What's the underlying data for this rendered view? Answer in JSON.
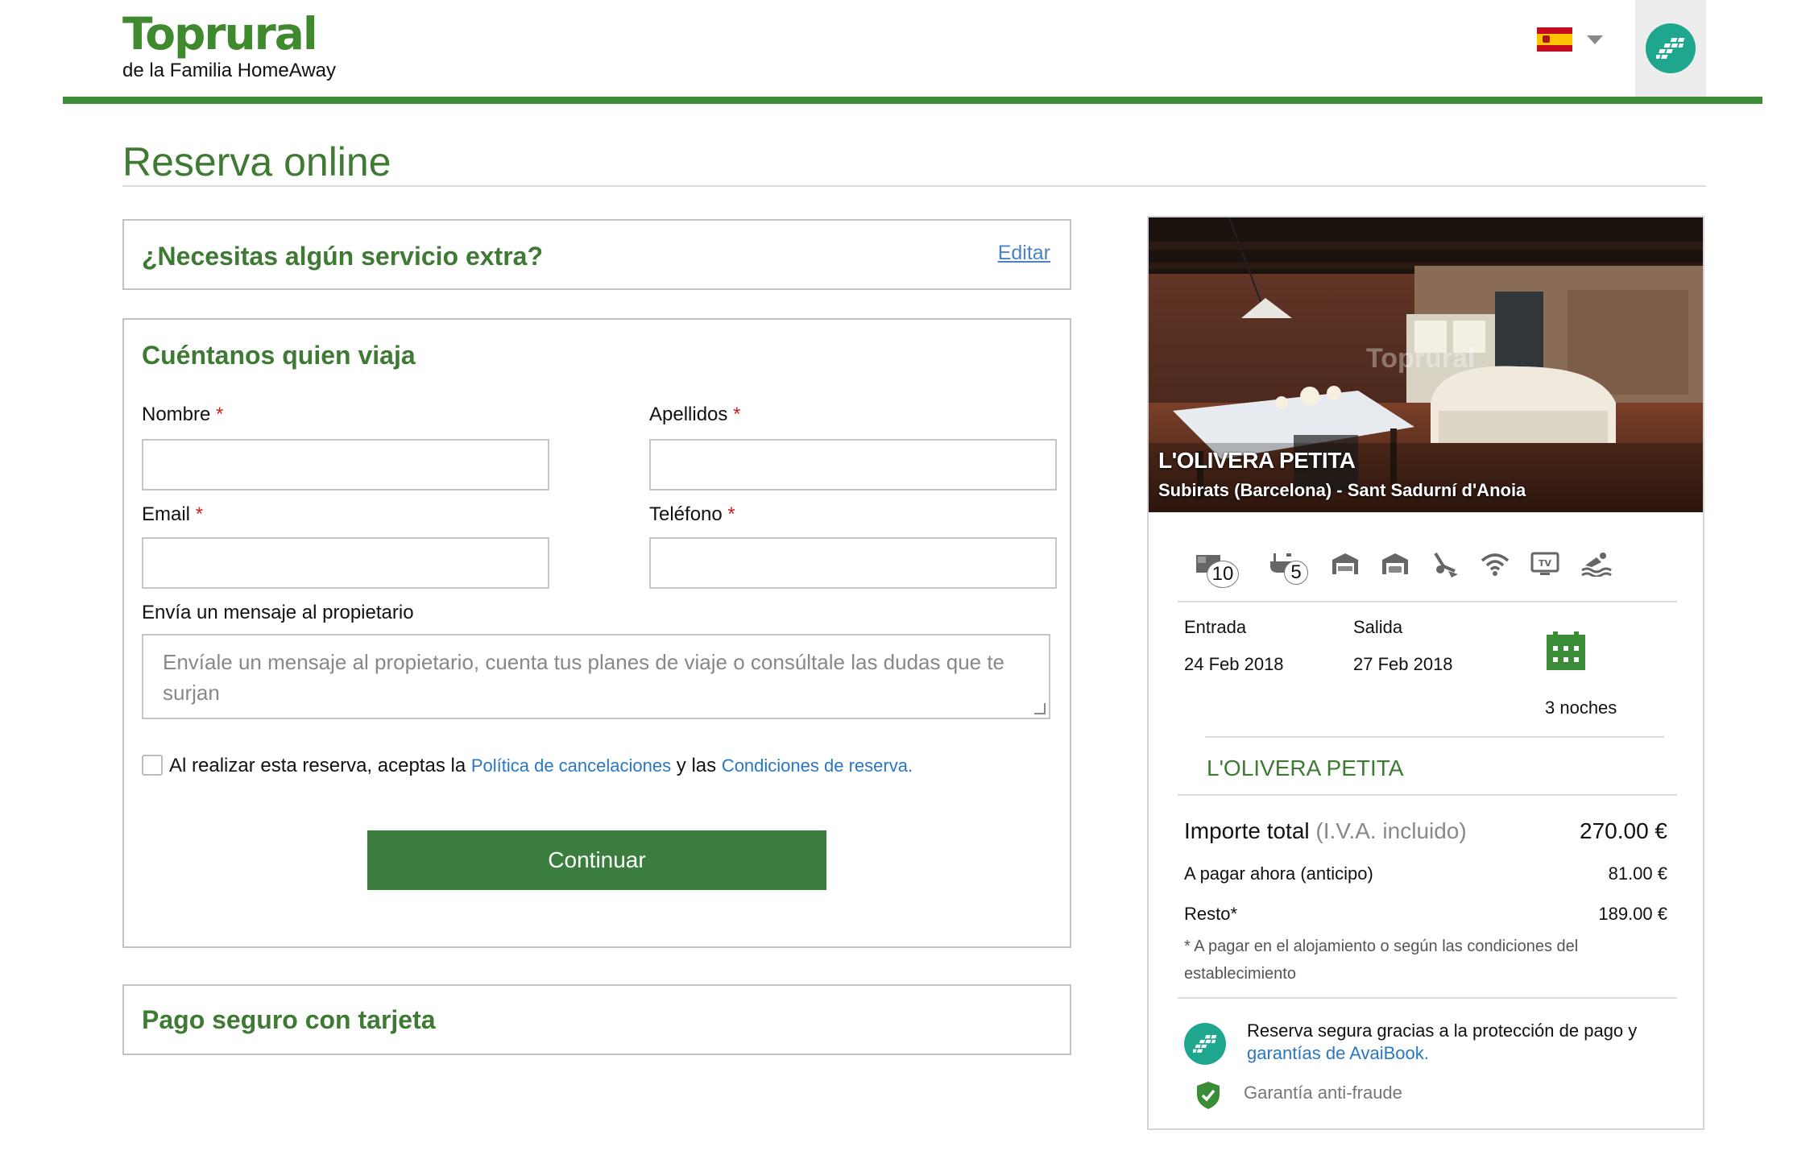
{
  "header": {
    "logo_name": "Toprural",
    "logo_sub": "de la Familia HomeAway",
    "language_flag": "spain-flag-icon",
    "avaibook_icon": "avaibook-logo-icon"
  },
  "page": {
    "title": "Reserva online"
  },
  "extras": {
    "title": "¿Necesitas algún servicio extra?",
    "edit_label": "Editar"
  },
  "travelers": {
    "title": "Cuéntanos quien viaja",
    "first_name_label": "Nombre",
    "last_name_label": "Apellidos",
    "email_label": "Email",
    "phone_label": "Teléfono",
    "required_mark": "*",
    "message_label": "Envía un mensaje al propietario",
    "message_placeholder": "Envíale un mensaje al propietario, cuenta tus planes de viaje o consúltale las dudas que te surjan",
    "terms_prefix": "Al realizar esta reserva, aceptas la",
    "terms_link_cancel": "Política de cancelaciones",
    "terms_middle": "y las",
    "terms_link_conditions": "Condiciones de reserva.",
    "continue_label": "Continuar"
  },
  "payment": {
    "title": "Pago seguro con tarjeta"
  },
  "sidebar": {
    "property_name": "L'OLIVERA PETITA",
    "property_location": "Subirats (Barcelona) - Sant Sadurní d'Anoia",
    "photo_watermark": "Toprural",
    "amenities": [
      {
        "icon": "bed-icon",
        "badge": "10"
      },
      {
        "icon": "bathtub-icon",
        "badge": "5"
      },
      {
        "icon": "garage-icon"
      },
      {
        "icon": "parking-icon"
      },
      {
        "icon": "garden-icon"
      },
      {
        "icon": "wifi-icon"
      },
      {
        "icon": "tv-icon"
      },
      {
        "icon": "pool-icon"
      }
    ],
    "checkin_label": "Entrada",
    "checkin_date": "24 Feb 2018",
    "checkout_label": "Salida",
    "checkout_date": "27 Feb 2018",
    "nights": "3 noches",
    "summary_title": "L'OLIVERA PETITA",
    "total_label": "Importe total",
    "total_note": "(I.V.A. incluido)",
    "total_value": "270.00 €",
    "deposit_label": "A pagar ahora (anticipo)",
    "deposit_value": "81.00 €",
    "rest_label": "Resto*",
    "rest_value": "189.00 €",
    "rest_note": "* A pagar en el alojamiento o según las condiciones del establecimiento",
    "secure_text": "Reserva segura gracias a la protección de pago y",
    "secure_link": "garantías de AvaiBook.",
    "antifraud": "Garantía anti-fraude"
  },
  "colors": {
    "brand_green": "#3f8a2f",
    "title_green": "#3f7a35",
    "button_green": "#3a7d3c",
    "link_blue": "#2a76c1",
    "avaibook_teal": "#1ea78e",
    "required_red": "#d0201f"
  }
}
